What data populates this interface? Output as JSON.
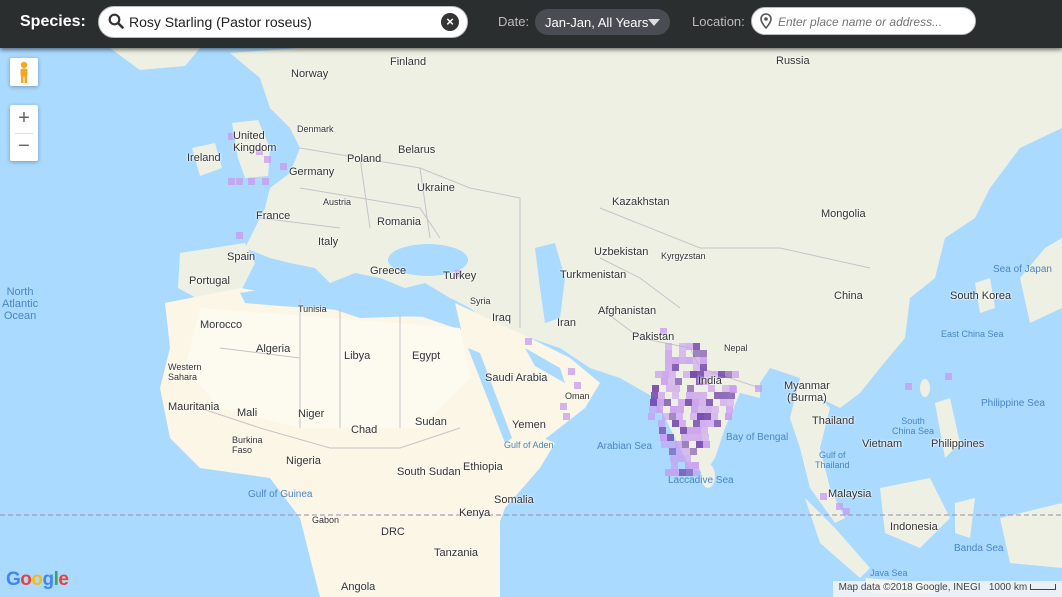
{
  "header": {
    "species_label": "Species:",
    "species_value": "Rosy Starling (Pastor roseus)",
    "date_label": "Date:",
    "date_value": "Jan-Jan, All Years",
    "location_label": "Location:",
    "location_placeholder": "Enter place name or address..."
  },
  "map": {
    "zoom_in": "+",
    "zoom_out": "−",
    "labels": {
      "north_atlantic": "North\nAtlantic\nOcean",
      "finland": "Finland",
      "norway": "Norway",
      "russia": "Russia",
      "uk": "United\nKingdom",
      "denmark": "Denmark",
      "ireland": "Ireland",
      "belarus": "Belarus",
      "poland": "Poland",
      "germany": "Germany",
      "ukraine": "Ukraine",
      "austria": "Austria",
      "france": "France",
      "romania": "Romania",
      "kazakhstan": "Kazakhstan",
      "mongolia": "Mongolia",
      "italy": "Italy",
      "spain": "Spain",
      "portugal": "Portugal",
      "greece": "Greece",
      "turkey": "Turkey",
      "uzbekistan": "Uzbekistan",
      "kyrgyzstan": "Kyrgyzstan",
      "turkmenistan": "Turkmenistan",
      "syria": "Syria",
      "tunisia": "Tunisia",
      "iraq": "Iraq",
      "iran": "Iran",
      "afghanistan": "Afghanistan",
      "china": "China",
      "sea_of_japan": "Sea of Japan",
      "south_korea": "South Korea",
      "morocco": "Morocco",
      "algeria": "Algeria",
      "libya": "Libya",
      "egypt": "Egypt",
      "pakistan": "Pakistan",
      "nepal": "Nepal",
      "east_china_sea": "East China Sea",
      "western_sahara": "Western\nSahara",
      "saudi_arabia": "Saudi Arabia",
      "india": "India",
      "myanmar": "Myanmar\n(Burma)",
      "philippine_sea": "Philippine Sea",
      "mauritania": "Mauritania",
      "mali": "Mali",
      "niger": "Niger",
      "oman": "Oman",
      "south_china_sea": "South\nChina Sea",
      "burkina_faso": "Burkina\nFaso",
      "chad": "Chad",
      "sudan": "Sudan",
      "yemen": "Yemen",
      "arabian_sea": "Arabian Sea",
      "bay_of_bengal": "Bay of Bengal",
      "thailand": "Thailand",
      "vietnam": "Vietnam",
      "philippines": "Philippines",
      "gulf_of_aden": "Gulf of Aden",
      "nigeria": "Nigeria",
      "gulf_of_thailand": "Gulf of\nThailand",
      "south_sudan": "South Sudan",
      "ethiopia": "Ethiopia",
      "gulf_of_guinea": "Gulf of Guinea",
      "laccadive_sea": "Laccadive Sea",
      "malaysia": "Malaysia",
      "somalia": "Somalia",
      "gabon": "Gabon",
      "kenya": "Kenya",
      "drc": "DRC",
      "indonesia": "Indonesia",
      "tanzania": "Tanzania",
      "banda_sea": "Banda Sea",
      "angola": "Angola",
      "java_sea": "Java Sea"
    },
    "logo": "Google",
    "attribution": "Map data ©2018 Google, INEGI",
    "scale": "1000 km"
  },
  "colors": {
    "topbar": "#2b2e2f",
    "water": "#aadaff",
    "land": "#eef0e4",
    "desert": "#fbf6e6",
    "heat_light": "#c89af0",
    "heat_dark": "#6a3aa8"
  }
}
